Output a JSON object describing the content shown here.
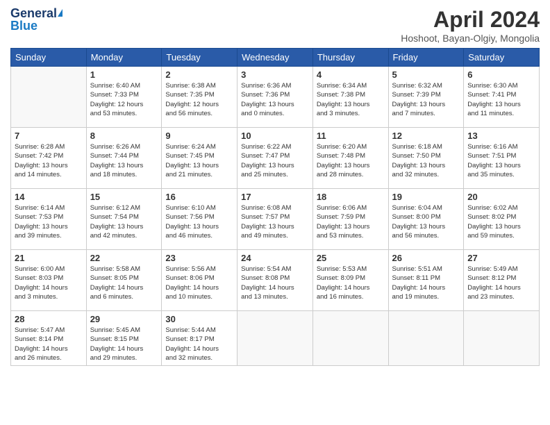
{
  "header": {
    "logo_line1": "General",
    "logo_line2": "Blue",
    "month_title": "April 2024",
    "location": "Hoshoot, Bayan-Olgiy, Mongolia"
  },
  "days_of_week": [
    "Sunday",
    "Monday",
    "Tuesday",
    "Wednesday",
    "Thursday",
    "Friday",
    "Saturday"
  ],
  "weeks": [
    [
      {
        "day": "",
        "info": ""
      },
      {
        "day": "1",
        "info": "Sunrise: 6:40 AM\nSunset: 7:33 PM\nDaylight: 12 hours\nand 53 minutes."
      },
      {
        "day": "2",
        "info": "Sunrise: 6:38 AM\nSunset: 7:35 PM\nDaylight: 12 hours\nand 56 minutes."
      },
      {
        "day": "3",
        "info": "Sunrise: 6:36 AM\nSunset: 7:36 PM\nDaylight: 13 hours\nand 0 minutes."
      },
      {
        "day": "4",
        "info": "Sunrise: 6:34 AM\nSunset: 7:38 PM\nDaylight: 13 hours\nand 3 minutes."
      },
      {
        "day": "5",
        "info": "Sunrise: 6:32 AM\nSunset: 7:39 PM\nDaylight: 13 hours\nand 7 minutes."
      },
      {
        "day": "6",
        "info": "Sunrise: 6:30 AM\nSunset: 7:41 PM\nDaylight: 13 hours\nand 11 minutes."
      }
    ],
    [
      {
        "day": "7",
        "info": "Sunrise: 6:28 AM\nSunset: 7:42 PM\nDaylight: 13 hours\nand 14 minutes."
      },
      {
        "day": "8",
        "info": "Sunrise: 6:26 AM\nSunset: 7:44 PM\nDaylight: 13 hours\nand 18 minutes."
      },
      {
        "day": "9",
        "info": "Sunrise: 6:24 AM\nSunset: 7:45 PM\nDaylight: 13 hours\nand 21 minutes."
      },
      {
        "day": "10",
        "info": "Sunrise: 6:22 AM\nSunset: 7:47 PM\nDaylight: 13 hours\nand 25 minutes."
      },
      {
        "day": "11",
        "info": "Sunrise: 6:20 AM\nSunset: 7:48 PM\nDaylight: 13 hours\nand 28 minutes."
      },
      {
        "day": "12",
        "info": "Sunrise: 6:18 AM\nSunset: 7:50 PM\nDaylight: 13 hours\nand 32 minutes."
      },
      {
        "day": "13",
        "info": "Sunrise: 6:16 AM\nSunset: 7:51 PM\nDaylight: 13 hours\nand 35 minutes."
      }
    ],
    [
      {
        "day": "14",
        "info": "Sunrise: 6:14 AM\nSunset: 7:53 PM\nDaylight: 13 hours\nand 39 minutes."
      },
      {
        "day": "15",
        "info": "Sunrise: 6:12 AM\nSunset: 7:54 PM\nDaylight: 13 hours\nand 42 minutes."
      },
      {
        "day": "16",
        "info": "Sunrise: 6:10 AM\nSunset: 7:56 PM\nDaylight: 13 hours\nand 46 minutes."
      },
      {
        "day": "17",
        "info": "Sunrise: 6:08 AM\nSunset: 7:57 PM\nDaylight: 13 hours\nand 49 minutes."
      },
      {
        "day": "18",
        "info": "Sunrise: 6:06 AM\nSunset: 7:59 PM\nDaylight: 13 hours\nand 53 minutes."
      },
      {
        "day": "19",
        "info": "Sunrise: 6:04 AM\nSunset: 8:00 PM\nDaylight: 13 hours\nand 56 minutes."
      },
      {
        "day": "20",
        "info": "Sunrise: 6:02 AM\nSunset: 8:02 PM\nDaylight: 13 hours\nand 59 minutes."
      }
    ],
    [
      {
        "day": "21",
        "info": "Sunrise: 6:00 AM\nSunset: 8:03 PM\nDaylight: 14 hours\nand 3 minutes."
      },
      {
        "day": "22",
        "info": "Sunrise: 5:58 AM\nSunset: 8:05 PM\nDaylight: 14 hours\nand 6 minutes."
      },
      {
        "day": "23",
        "info": "Sunrise: 5:56 AM\nSunset: 8:06 PM\nDaylight: 14 hours\nand 10 minutes."
      },
      {
        "day": "24",
        "info": "Sunrise: 5:54 AM\nSunset: 8:08 PM\nDaylight: 14 hours\nand 13 minutes."
      },
      {
        "day": "25",
        "info": "Sunrise: 5:53 AM\nSunset: 8:09 PM\nDaylight: 14 hours\nand 16 minutes."
      },
      {
        "day": "26",
        "info": "Sunrise: 5:51 AM\nSunset: 8:11 PM\nDaylight: 14 hours\nand 19 minutes."
      },
      {
        "day": "27",
        "info": "Sunrise: 5:49 AM\nSunset: 8:12 PM\nDaylight: 14 hours\nand 23 minutes."
      }
    ],
    [
      {
        "day": "28",
        "info": "Sunrise: 5:47 AM\nSunset: 8:14 PM\nDaylight: 14 hours\nand 26 minutes."
      },
      {
        "day": "29",
        "info": "Sunrise: 5:45 AM\nSunset: 8:15 PM\nDaylight: 14 hours\nand 29 minutes."
      },
      {
        "day": "30",
        "info": "Sunrise: 5:44 AM\nSunset: 8:17 PM\nDaylight: 14 hours\nand 32 minutes."
      },
      {
        "day": "",
        "info": ""
      },
      {
        "day": "",
        "info": ""
      },
      {
        "day": "",
        "info": ""
      },
      {
        "day": "",
        "info": ""
      }
    ]
  ]
}
